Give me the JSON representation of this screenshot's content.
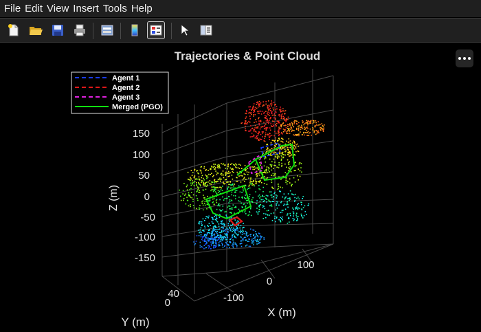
{
  "menu": {
    "file": "File",
    "edit": "Edit",
    "view": "View",
    "insert": "Insert",
    "tools": "Tools",
    "help": "Help"
  },
  "toolbar_icons": [
    "new-figure-icon",
    "open-icon",
    "save-icon",
    "print-icon",
    "print-preview-icon",
    "colorbar-icon",
    "legend-icon",
    "pointer-icon",
    "property-editor-icon"
  ],
  "plot": {
    "title": "Trajectories & Point Cloud",
    "xlabel": "X (m)",
    "ylabel": "Y (m)",
    "zlabel": "Z (m)",
    "x_ticks": [
      "-100",
      "0",
      "100"
    ],
    "y_ticks": [
      "40",
      "0"
    ],
    "z_ticks": [
      "150",
      "100",
      "50",
      "0",
      "-50",
      "-100",
      "-150"
    ],
    "legend": [
      {
        "label": "Agent 1",
        "color": "#1a3cff",
        "style": "dashed"
      },
      {
        "label": "Agent 2",
        "color": "#e01818",
        "style": "dashed"
      },
      {
        "label": "Agent 3",
        "color": "#e020e0",
        "style": "dashed"
      },
      {
        "label": "Merged (PGO)",
        "color": "#10e010",
        "style": "solid"
      }
    ]
  },
  "colors": {
    "menubar_bg": "#1f1f1f",
    "figure_bg": "#000000",
    "grid": "#4a4a4a",
    "axis_text": "#e6e6e6"
  }
}
